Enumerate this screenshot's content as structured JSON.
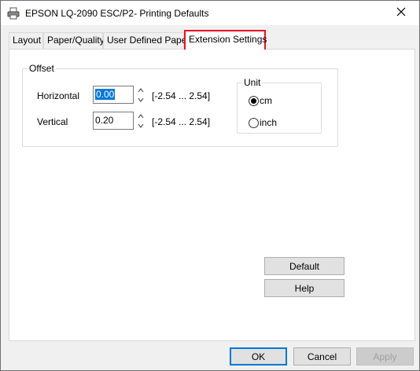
{
  "window": {
    "title": "EPSON LQ-2090 ESC/P2- Printing Defaults",
    "icon": "printer-icon",
    "close_icon": "close-icon"
  },
  "tabs": [
    {
      "label": "Layout",
      "active": false
    },
    {
      "label": "Paper/Quality",
      "active": false
    },
    {
      "label": "User Defined Paper",
      "active": false
    },
    {
      "label": "Extension Settings",
      "active": true
    }
  ],
  "offset": {
    "group_label": "Offset",
    "horizontal": {
      "label": "Horizontal",
      "value": "0.00",
      "range": "[-2.54 ... 2.54]"
    },
    "vertical": {
      "label": "Vertical",
      "value": "0.20",
      "range": "[-2.54 ... 2.54]"
    }
  },
  "unit": {
    "group_label": "Unit",
    "options": [
      {
        "label": "cm",
        "checked": true
      },
      {
        "label": "inch",
        "checked": false
      }
    ]
  },
  "panel_buttons": {
    "default_label": "Default",
    "help_label": "Help"
  },
  "footer": {
    "ok_label": "OK",
    "cancel_label": "Cancel",
    "apply_label": "Apply"
  },
  "colors": {
    "active_tab_highlight": "#e81123",
    "selection": "#0078d7"
  }
}
